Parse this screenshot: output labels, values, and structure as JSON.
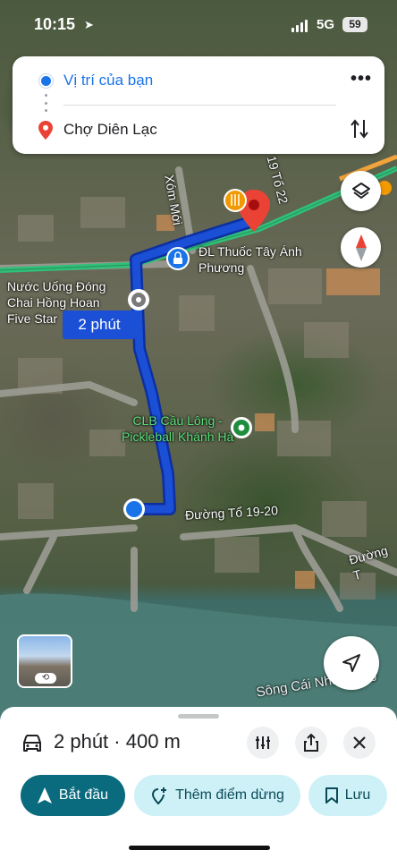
{
  "status_bar": {
    "time": "10:15",
    "network": "5G",
    "battery": "59"
  },
  "directions": {
    "origin": "Vị trí của bạn",
    "destination": "Chợ Diên Lạc",
    "more_icon": "more-vert-icon",
    "swap_icon": "swap-vertical-icon"
  },
  "map": {
    "route_time_label": "2 phút",
    "labels": {
      "xom_moi": "Xóm Mới",
      "to22": "19 Tổ 22",
      "pharmacy_line1": "ĐL Thuốc Tây Ánh",
      "pharmacy_line2": "Phương",
      "water_line1": "Nước Uống Đóng",
      "water_line2": "Chai Hồng Hoan",
      "water_line3": "Five Star",
      "club_line1": "CLB Cầu Lông -",
      "club_line2": "Pickleball Khánh Hà",
      "road_to1920": "Đường Tổ 19-20",
      "road_right": "Đường T",
      "river": "Sông Cái Nha Trang"
    },
    "colors": {
      "route": "#1a4fd6",
      "route_outline": "#0d2fa0",
      "destination_pin": "#ea4335",
      "poi_green": "#5be07a",
      "road_green": "#2fc079"
    }
  },
  "route_sheet": {
    "summary": "2 phút · 400 m",
    "buttons": {
      "start": "Bắt đầu",
      "add_stop": "Thêm điểm dừng",
      "save": "Lưu"
    },
    "accent_color": "#0b6b7e"
  }
}
